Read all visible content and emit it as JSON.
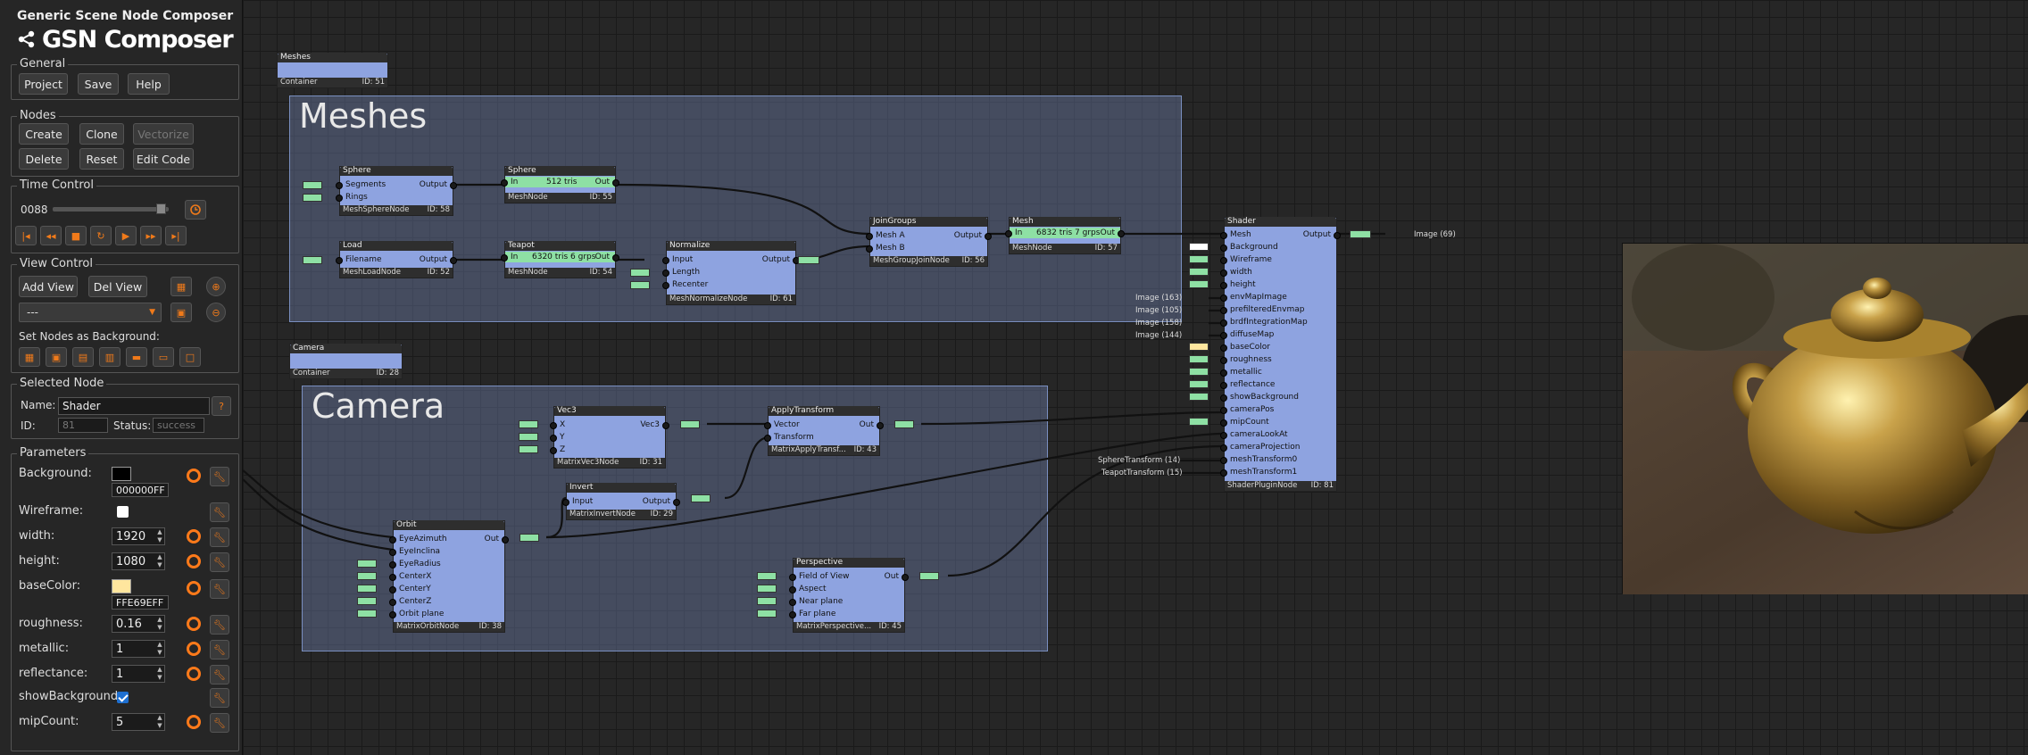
{
  "app": {
    "title": "Generic Scene Node Composer",
    "logo_text": "GSN Composer"
  },
  "general": {
    "legend": "General",
    "buttons": [
      "Project",
      "Save",
      "Help"
    ]
  },
  "nodes_group": {
    "legend": "Nodes",
    "create": "Create",
    "clone": "Clone",
    "vectorize": "Vectorize",
    "delete": "Delete",
    "reset": "Reset",
    "edit_code": "Edit Code"
  },
  "time": {
    "legend": "Time Control",
    "frame": "0088"
  },
  "view": {
    "legend": "View Control",
    "add": "Add View",
    "del": "Del View",
    "select_value": "---",
    "bg_label": "Set Nodes as Background:"
  },
  "selected": {
    "legend": "Selected Node",
    "name_label": "Name:",
    "name_value": "Shader",
    "help": "?",
    "id_label": "ID:",
    "id_value": "81",
    "status_label": "Status:",
    "status_value": "success"
  },
  "params": {
    "legend": "Parameters",
    "items": [
      {
        "label": "Background:",
        "value": "000000FF",
        "swatch": "#000000"
      },
      {
        "label": "Wireframe:",
        "checked": false
      },
      {
        "label": "width:",
        "value": "1920"
      },
      {
        "label": "height:",
        "value": "1080"
      },
      {
        "label": "baseColor:",
        "value": "FFE69EFF",
        "swatch": "#ffe69e"
      },
      {
        "label": "roughness:",
        "value": "0.16"
      },
      {
        "label": "metallic:",
        "value": "1"
      },
      {
        "label": "reflectance:",
        "value": "1"
      },
      {
        "label": "showBackground:",
        "checked": true
      },
      {
        "label": "mipCount:",
        "value": "5"
      }
    ]
  },
  "graph": {
    "containers": [
      {
        "title": "Meshes",
        "big": "Meshes",
        "footer": "Container",
        "id": "ID: 51"
      },
      {
        "title": "Camera",
        "big": "Camera",
        "footer": "Container",
        "id": "ID: 28"
      }
    ],
    "nodes": {
      "sphere1": {
        "title": "Sphere",
        "in": [
          "Segments",
          "Rings"
        ],
        "out": "Output",
        "type": "MeshSphereNode",
        "id": "ID: 58"
      },
      "sphere2": {
        "title": "Sphere",
        "in": [
          "In"
        ],
        "info": "512 tris",
        "out": "Out",
        "type": "MeshNode",
        "id": "ID: 55"
      },
      "load": {
        "title": "Load",
        "in": [
          "Filename"
        ],
        "out": "Output",
        "type": "MeshLoadNode",
        "id": "ID: 52"
      },
      "teapot": {
        "title": "Teapot",
        "in": [
          "In"
        ],
        "info": "6320 tris 6 grps",
        "out": "Out",
        "type": "MeshNode",
        "id": "ID: 54"
      },
      "normalize": {
        "title": "Normalize",
        "in": [
          "Input",
          "Length",
          "Recenter"
        ],
        "out": "Output",
        "type": "MeshNormalizeNode",
        "id": "ID: 61"
      },
      "join": {
        "title": "JoinGroups",
        "in": [
          "Mesh A",
          "Mesh B"
        ],
        "out": "Output",
        "type": "MeshGroupJoinNode",
        "id": "ID: 56"
      },
      "mesh": {
        "title": "Mesh",
        "in": [
          "In"
        ],
        "info": "6832 tris 7 grps",
        "out": "Out",
        "type": "MeshNode",
        "id": "ID: 57"
      },
      "vec3": {
        "title": "Vec3",
        "in": [
          "X",
          "Y",
          "Z"
        ],
        "out": "Vec3",
        "type": "MatrixVec3Node",
        "id": "ID: 31"
      },
      "apply": {
        "title": "ApplyTransform",
        "in": [
          "Vector",
          "Transform"
        ],
        "out": "Out",
        "type": "MatrixApplyTransf...",
        "id": "ID: 43"
      },
      "invert": {
        "title": "Invert",
        "in": [
          "Input"
        ],
        "out": "Output",
        "type": "MatrixInvertNode",
        "id": "ID: 29"
      },
      "orbit": {
        "title": "Orbit",
        "in": [
          "EyeAzimuth",
          "EyeInclina",
          "EyeRadius",
          "CenterX",
          "CenterY",
          "CenterZ",
          "Orbit plane"
        ],
        "out": "Out",
        "type": "MatrixOrbitNode",
        "id": "ID: 38"
      },
      "persp": {
        "title": "Perspective",
        "in": [
          "Field of View",
          "Aspect",
          "Near plane",
          "Far plane"
        ],
        "out": "Out",
        "type": "MatrixPerspective...",
        "id": "ID: 45"
      },
      "shader": {
        "title": "Shader",
        "in": [
          "Mesh",
          "Background",
          "Wireframe",
          "width",
          "height",
          "envMapImage",
          "prefilteredEnvmap",
          "brdfIntegrationMap",
          "diffuseMap",
          "baseColor",
          "roughness",
          "metallic",
          "reflectance",
          "showBackground",
          "cameraPos",
          "mipCount",
          "cameraLookAt",
          "cameraProjection",
          "meshTransform0",
          "meshTransform1"
        ],
        "out": "Output",
        "type": "ShaderPluginNode",
        "id": "ID: 81"
      }
    },
    "ext_labels": {
      "img1": "Image (163)",
      "img2": "Image (105)",
      "img3": "Image (158)",
      "img4": "Image (144)",
      "st14": "SphereTransform (14)",
      "st15": "TeapotTransform (15)",
      "out_img": "Image (69)"
    }
  },
  "icons": {
    "logo": "share-nodes-icon",
    "clock": "clock-icon",
    "first": "skip-first-icon",
    "prev": "step-back-icon",
    "stop": "stop-icon",
    "loop": "loop-icon",
    "play": "play-icon",
    "next": "step-forward-icon",
    "last": "skip-last-icon"
  },
  "colors": {
    "node_blue": "#8ea3e0",
    "node_green": "#8ee0a4",
    "accent_orange": "#ff7a1a"
  }
}
